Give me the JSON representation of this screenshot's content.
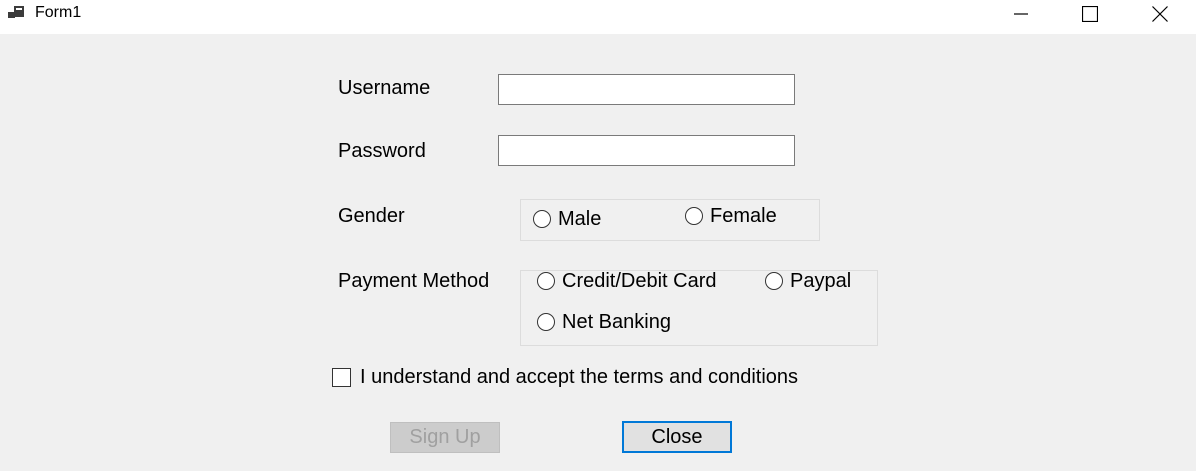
{
  "window": {
    "title": "Form1",
    "controls": {
      "minimize": "minimize-icon",
      "maximize": "maximize-icon",
      "close": "close-icon"
    }
  },
  "form": {
    "username": {
      "label": "Username",
      "value": ""
    },
    "password": {
      "label": "Password",
      "value": ""
    },
    "gender": {
      "label": "Gender",
      "options": [
        "Male",
        "Female"
      ],
      "selected": null
    },
    "payment": {
      "label": "Payment Method",
      "options": [
        "Credit/Debit Card",
        "Paypal",
        "Net Banking"
      ],
      "selected": null
    },
    "terms": {
      "label": "I understand and accept the terms and conditions",
      "checked": false
    },
    "buttons": {
      "signup": "Sign Up",
      "close": "Close"
    }
  },
  "colors": {
    "background": "#f0f0f0",
    "titlebar": "#ffffff",
    "focus_border": "#0078d7",
    "disabled_button": "#cccccc",
    "disabled_text": "#a0a0a0"
  }
}
